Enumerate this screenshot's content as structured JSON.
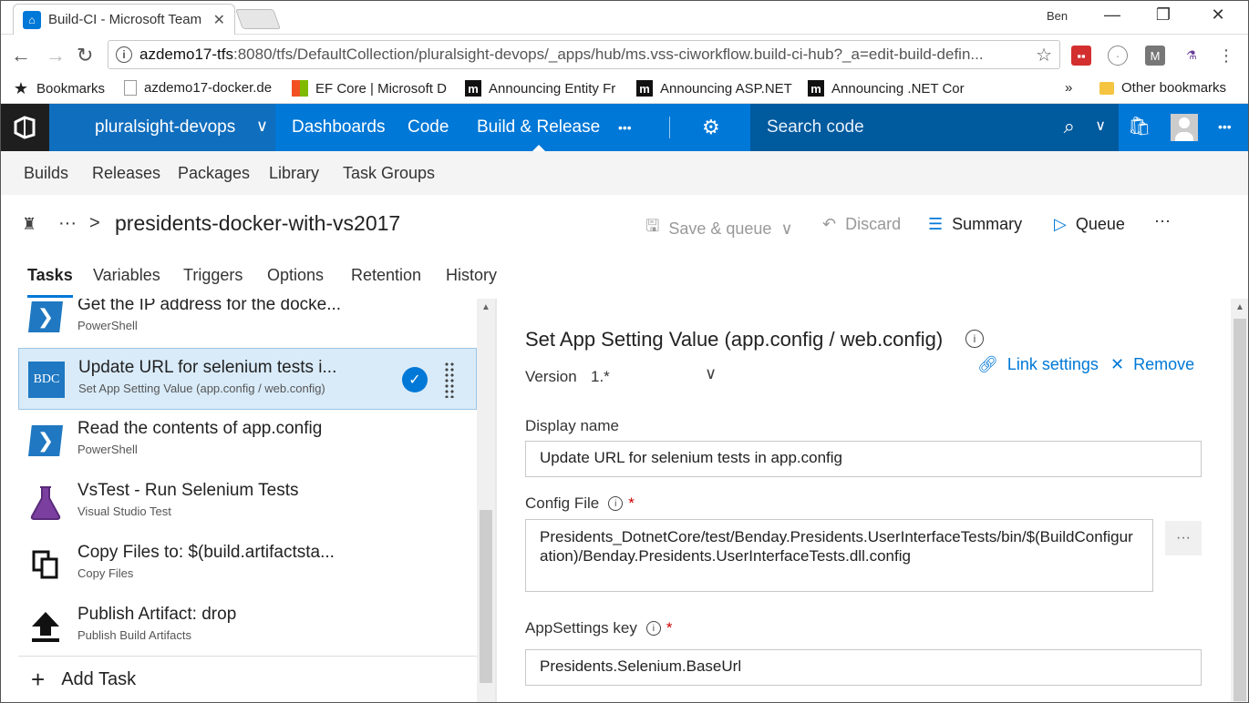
{
  "browser": {
    "tab_title": "Build-CI - Microsoft Team",
    "user": "Ben",
    "url_host": "azdemo17-tfs",
    "url_rest": ":8080/tfs/DefaultCollection/pluralsight-devops/_apps/hub/ms.vss-ciworkflow.build-ci-hub?_a=edit-build-defin...",
    "bookmarks_label": "Bookmarks",
    "bookmark_items": [
      {
        "label": "azdemo17-docker.de",
        "icon": "page-icon"
      },
      {
        "label": "EF Core | Microsoft D",
        "icon": "microsoft-icon"
      },
      {
        "label": "Announcing Entity Fr",
        "icon": "m-icon"
      },
      {
        "label": "Announcing ASP.NET",
        "icon": "m-icon"
      },
      {
        "label": "Announcing .NET Cor",
        "icon": "m-icon"
      }
    ],
    "bookmarks_overflow": "»",
    "other_bookmarks": "Other bookmarks"
  },
  "header": {
    "project": "pluralsight-devops",
    "hubs": [
      "Dashboards",
      "Code",
      "Build & Release"
    ],
    "more": "•••",
    "search_placeholder": "Search code",
    "more_menu": "•••"
  },
  "subnav": [
    "Builds",
    "Releases",
    "Packages",
    "Library",
    "Task Groups"
  ],
  "definition": {
    "breadcrumb_more": "···",
    "breadcrumb_sep": ">",
    "title": "presidents-docker-with-vs2017",
    "toolbar": {
      "save_queue": "Save & queue",
      "discard": "Discard",
      "summary": "Summary",
      "queue": "Queue",
      "more": "···"
    }
  },
  "tabs": [
    "Tasks",
    "Variables",
    "Triggers",
    "Options",
    "Retention",
    "History"
  ],
  "tasks": [
    {
      "name": "Get the IP address for the docke...",
      "type": "PowerShell",
      "icon": "powershell-icon"
    },
    {
      "name": "Update URL for selenium tests i...",
      "type": "Set App Setting Value (app.config / web.config)",
      "icon": "bdc-icon",
      "badge": "BDC"
    },
    {
      "name": "Read the contents of app.config",
      "type": "PowerShell",
      "icon": "powershell-icon"
    },
    {
      "name": "VsTest - Run Selenium Tests",
      "type": "Visual Studio Test",
      "icon": "flask-icon"
    },
    {
      "name": "Copy Files to: $(build.artifactsta...",
      "type": "Copy Files",
      "icon": "copy-files-icon"
    },
    {
      "name": "Publish Artifact: drop",
      "type": "Publish Build Artifacts",
      "icon": "upload-icon"
    }
  ],
  "add_task": "Add Task",
  "details": {
    "title": "Set App Setting Value (app.config / web.config)",
    "version_label": "Version",
    "version_value": "1.*",
    "link_settings": "Link settings",
    "remove": "Remove",
    "display_name_label": "Display name",
    "display_name_value": "Update URL for selenium tests in app.config",
    "config_file_label": "Config File",
    "config_file_value": "Presidents_DotnetCore/test/Benday.Presidents.UserInterfaceTests/bin/$(BuildConfiguration)/Benday.Presidents.UserInterfaceTests.dll.config",
    "appsettings_key_label": "AppSettings key",
    "appsettings_key_value": "Presidents.Selenium.BaseUrl",
    "required_mark": "*",
    "ellipsis": "···"
  },
  "colors": {
    "accent": "#0078d7",
    "header_dark": "#005a9e",
    "selected_row": "#d9ebf9"
  }
}
